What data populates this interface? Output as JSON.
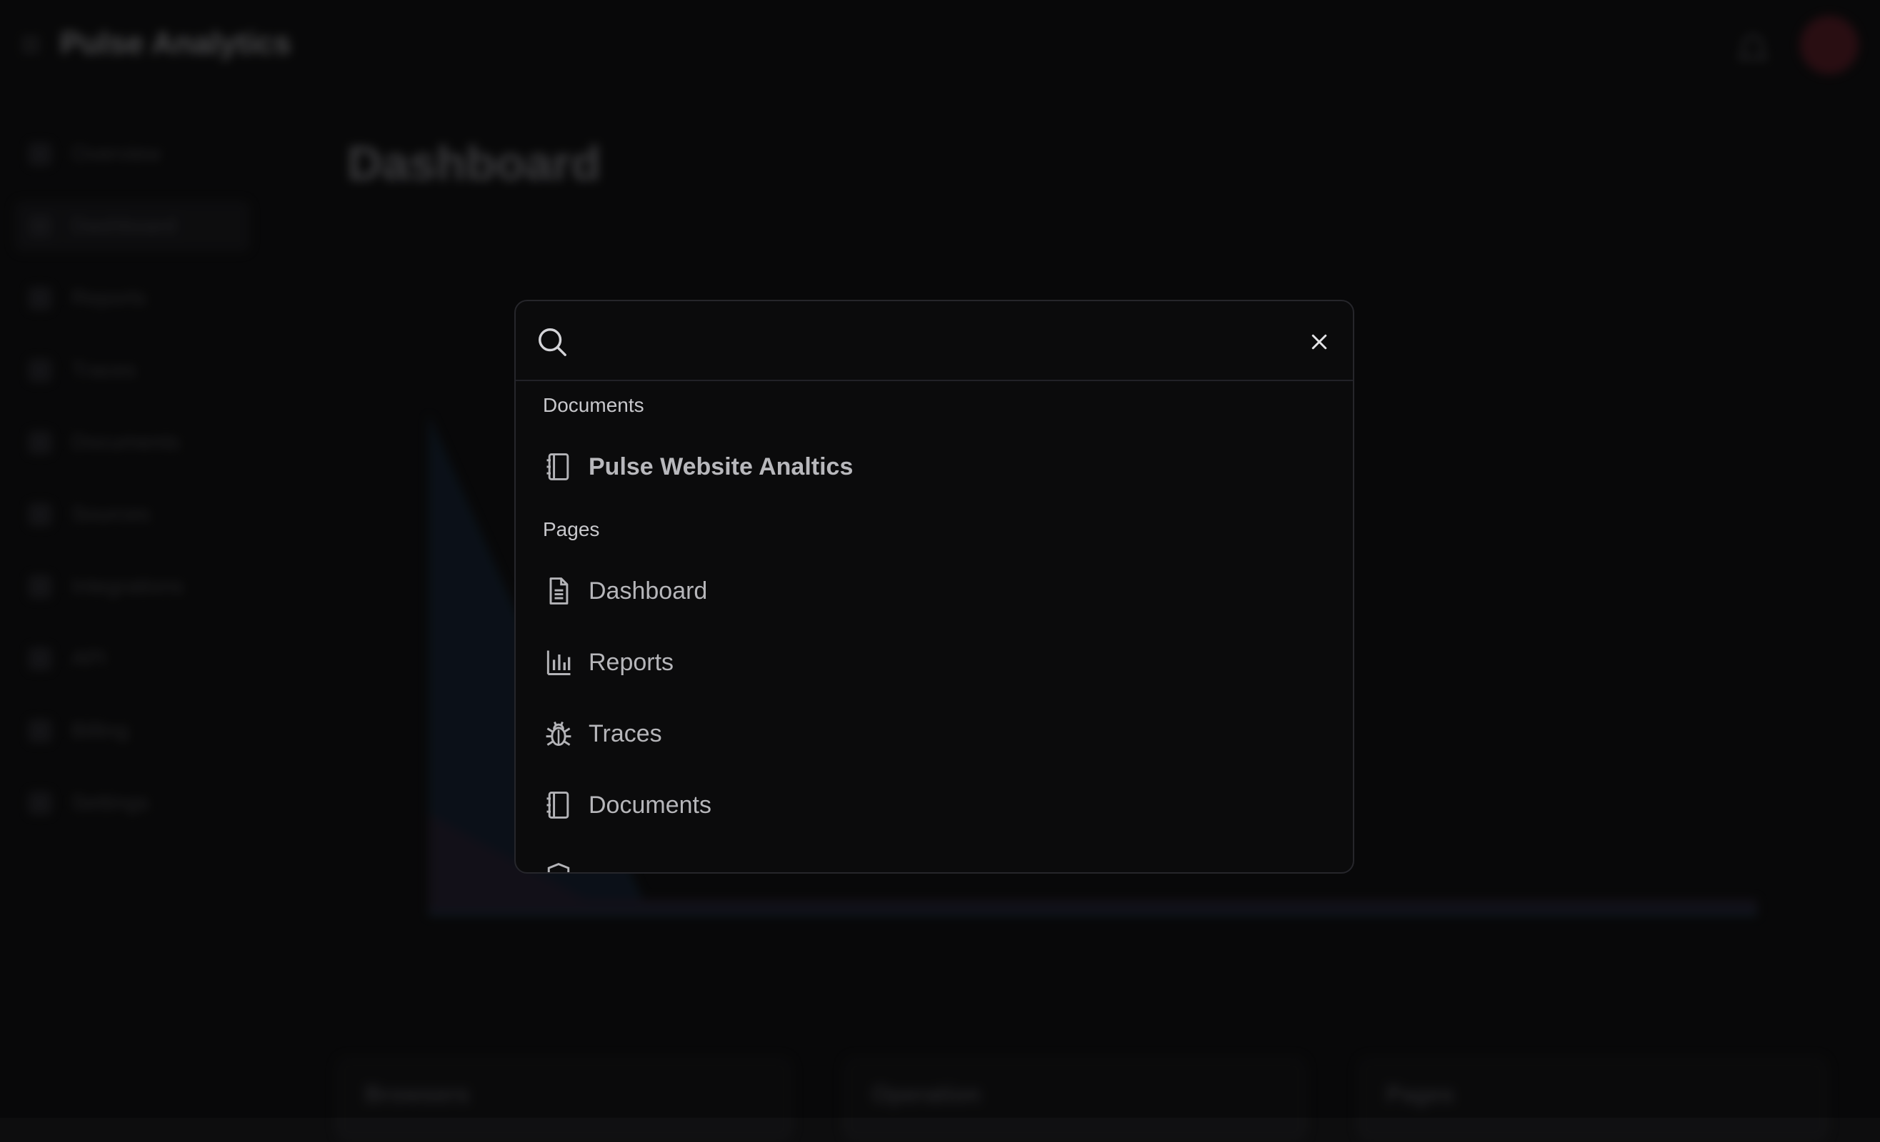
{
  "app": {
    "brand": "Pulse Analytics",
    "page_title": "Dashboard",
    "sidebar": [
      {
        "label": "Overview"
      },
      {
        "label": "Dashboard"
      },
      {
        "label": "Reports"
      },
      {
        "label": "Traces"
      },
      {
        "label": "Documents"
      },
      {
        "label": "Sources"
      },
      {
        "label": "Integrations"
      },
      {
        "label": "API"
      },
      {
        "label": "Billing"
      },
      {
        "label": "Settings"
      }
    ],
    "cards": [
      {
        "title": "Browsers"
      },
      {
        "title": "Operation"
      },
      {
        "title": "Pages"
      }
    ],
    "colors": {
      "avatar": "#6a1e2a",
      "accent_series": "#1c3a55"
    }
  },
  "command_palette": {
    "search": {
      "value": "",
      "placeholder": ""
    },
    "groups": [
      {
        "label": "Documents",
        "items": [
          {
            "label": "Pulse Website Analtics",
            "icon": "notebook-icon",
            "highlighted": true
          }
        ]
      },
      {
        "label": "Pages",
        "items": [
          {
            "label": "Dashboard",
            "icon": "document-icon"
          },
          {
            "label": "Reports",
            "icon": "bar-chart-icon"
          },
          {
            "label": "Traces",
            "icon": "bug-icon"
          },
          {
            "label": "Documents",
            "icon": "notebook-icon"
          }
        ]
      }
    ]
  }
}
